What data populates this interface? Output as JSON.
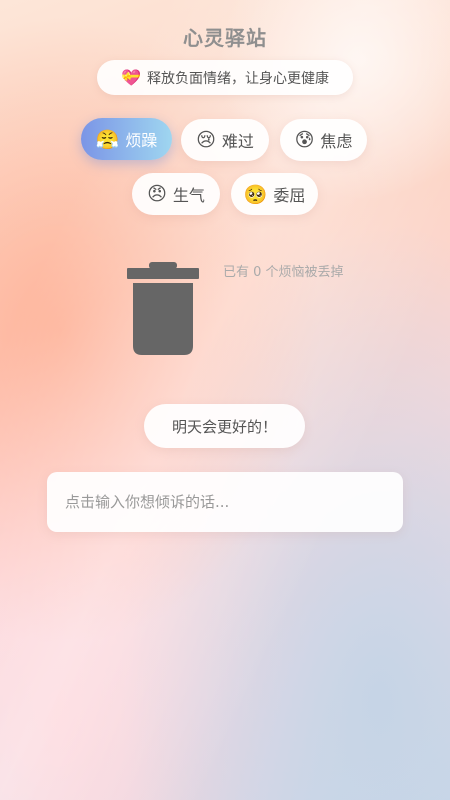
{
  "header": {
    "title": "心灵驿站"
  },
  "subtitle": {
    "icon": "💝",
    "text": "释放负面情绪，让身心更健康"
  },
  "moods": [
    {
      "emoji": "😤",
      "label": "烦躁",
      "active": true
    },
    {
      "emoji": "😢",
      "label": "难过",
      "active": false
    },
    {
      "emoji": "😰",
      "label": "焦虑",
      "active": false
    },
    {
      "emoji": "😠",
      "label": "生气",
      "active": false
    },
    {
      "emoji": "🥺",
      "label": "委屈",
      "active": false
    }
  ],
  "trash": {
    "counter_text": "已有 0 个烦恼被丢掉",
    "icon": "trash-can-icon"
  },
  "cheer": {
    "text": "明天会更好的！"
  },
  "input": {
    "placeholder": "点击输入你想倾诉的话...",
    "value": ""
  }
}
